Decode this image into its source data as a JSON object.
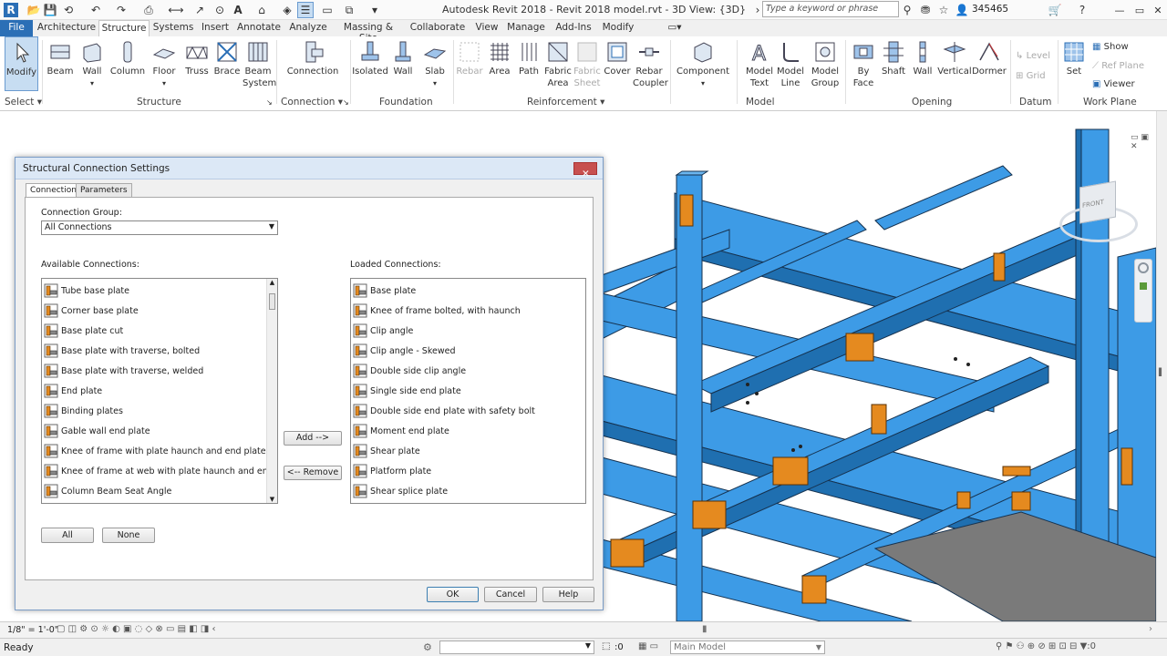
{
  "app": {
    "title": "Autodesk Revit 2018 -   Revit 2018 model.rvt - 3D View: {3D}",
    "search_placeholder": "Type a keyword or phrase",
    "user": "345465",
    "logo": "R"
  },
  "ribbon_tabs": [
    "File",
    "Architecture",
    "Structure",
    "Systems",
    "Insert",
    "Annotate",
    "Analyze",
    "Massing & Site",
    "Collaborate",
    "View",
    "Manage",
    "Add-Ins",
    "Modify"
  ],
  "ribbon": {
    "select": {
      "modify": "Modify",
      "label": "Select"
    },
    "structure": {
      "items": [
        "Beam",
        "Wall",
        "Column",
        "Floor",
        "Truss",
        "Brace",
        "Beam",
        "System"
      ],
      "label": "Structure"
    },
    "connection": {
      "item": "Connection",
      "label": "Connection"
    },
    "foundation": {
      "items": [
        "Isolated",
        "Wall",
        "Slab"
      ],
      "label": "Foundation"
    },
    "reinforcement": {
      "items": [
        "Rebar",
        "Area",
        "Path",
        "Fabric",
        "Area",
        "Fabric",
        "Sheet",
        "Cover",
        "Rebar",
        "Coupler"
      ],
      "label": "Reinforcement"
    },
    "component": {
      "item": "Component"
    },
    "model": {
      "items": [
        "Model",
        "Text",
        "Model",
        "Line",
        "Model",
        "Group"
      ],
      "label": "Model"
    },
    "opening": {
      "items": [
        "By",
        "Face",
        "Shaft",
        "Wall",
        "Vertical",
        "Dormer"
      ],
      "label": "Opening"
    },
    "datum": {
      "items": [
        "Level",
        "Grid"
      ],
      "label": "Datum"
    },
    "work_plane": {
      "items": [
        "Set",
        "Show",
        "Ref  Plane",
        "Viewer"
      ],
      "label": "Work Plane"
    }
  },
  "dialog": {
    "title": "Structural Connection Settings",
    "tabs": [
      "Connections",
      "Parameters"
    ],
    "group_label": "Connection Group:",
    "group_value": "All Connections",
    "available_label": "Available Connections:",
    "loaded_label": "Loaded Connections:",
    "available": [
      "Tube base plate",
      "Corner base plate",
      "Base plate cut",
      "Base plate with traverse, bolted",
      "Base plate with traverse, welded",
      "End plate",
      "Binding plates",
      "Gable wall end plate",
      "Knee of frame with plate haunch and end plate",
      "Knee of frame at web with plate haunch and end plate",
      "Column Beam Seat Angle"
    ],
    "loaded": [
      "Base plate",
      "Knee of frame bolted, with haunch",
      "Clip angle",
      "Clip angle - Skewed",
      "Double side clip angle",
      "Single side end plate",
      "Double side end plate with safety bolt",
      "Moment end plate",
      "Shear plate",
      "Platform plate",
      "Shear splice plate"
    ],
    "add_button": "Add -->",
    "remove_button": "<-- Remove",
    "all_button": "All",
    "none_button": "None",
    "ok": "OK",
    "cancel": "Cancel",
    "help": "Help"
  },
  "viewbar": {
    "scale": "1/8\" = 1'-0\""
  },
  "status": {
    "text": "Ready",
    "count": ":0",
    "model": "Main Model"
  },
  "viewcube": {
    "label": "FRONT"
  },
  "colors": {
    "steel": "#3d9be6",
    "connection": "#e58a1f",
    "accent": "#2b6fb6"
  }
}
